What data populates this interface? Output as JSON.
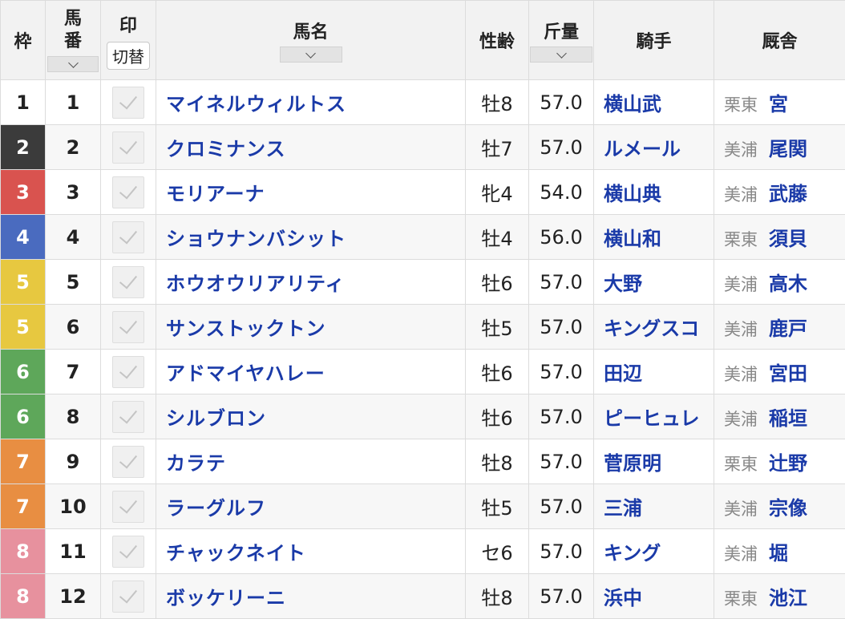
{
  "header": {
    "waku": "枠",
    "umaban_line1": "馬",
    "umaban_line2": "番",
    "mark": "印",
    "mark_toggle": "切替",
    "name": "馬名",
    "sexage": "性齢",
    "weight": "斤量",
    "jockey": "騎手",
    "stable": "厩舎"
  },
  "colors": {
    "link": "#1a3aa8",
    "waku": {
      "1": "#ffffff",
      "2": "#3b3b3b",
      "3": "#d9534f",
      "4": "#4a6bbf",
      "5": "#e7c840",
      "6": "#5ea75a",
      "7": "#e88e42",
      "8": "#e7919e"
    },
    "waku_text": {
      "1": "#222222",
      "2": "#ffffff",
      "3": "#ffffff",
      "4": "#ffffff",
      "5": "#ffffff",
      "6": "#ffffff",
      "7": "#ffffff",
      "8": "#ffffff"
    }
  },
  "rows": [
    {
      "waku": "1",
      "umaban": "1",
      "name": "マイネルウィルトス",
      "sexage": "牡8",
      "weight": "57.0",
      "jockey": "横山武",
      "region": "栗東",
      "trainer": "宮"
    },
    {
      "waku": "2",
      "umaban": "2",
      "name": "クロミナンス",
      "sexage": "牡7",
      "weight": "57.0",
      "jockey": "ルメール",
      "region": "美浦",
      "trainer": "尾関"
    },
    {
      "waku": "3",
      "umaban": "3",
      "name": "モリアーナ",
      "sexage": "牝4",
      "weight": "54.0",
      "jockey": "横山典",
      "region": "美浦",
      "trainer": "武藤"
    },
    {
      "waku": "4",
      "umaban": "4",
      "name": "ショウナンバシット",
      "sexage": "牡4",
      "weight": "56.0",
      "jockey": "横山和",
      "region": "栗東",
      "trainer": "須貝"
    },
    {
      "waku": "5",
      "umaban": "5",
      "name": "ホウオウリアリティ",
      "sexage": "牡6",
      "weight": "57.0",
      "jockey": "大野",
      "region": "美浦",
      "trainer": "高木"
    },
    {
      "waku": "5",
      "umaban": "6",
      "name": "サンストックトン",
      "sexage": "牡5",
      "weight": "57.0",
      "jockey": "キングスコ",
      "region": "美浦",
      "trainer": "鹿戸"
    },
    {
      "waku": "6",
      "umaban": "7",
      "name": "アドマイヤハレー",
      "sexage": "牡6",
      "weight": "57.0",
      "jockey": "田辺",
      "region": "美浦",
      "trainer": "宮田"
    },
    {
      "waku": "6",
      "umaban": "8",
      "name": "シルブロン",
      "sexage": "牡6",
      "weight": "57.0",
      "jockey": "ピーヒュレ",
      "region": "美浦",
      "trainer": "稲垣"
    },
    {
      "waku": "7",
      "umaban": "9",
      "name": "カラテ",
      "sexage": "牡8",
      "weight": "57.0",
      "jockey": "菅原明",
      "region": "栗東",
      "trainer": "辻野"
    },
    {
      "waku": "7",
      "umaban": "10",
      "name": "ラーグルフ",
      "sexage": "牡5",
      "weight": "57.0",
      "jockey": "三浦",
      "region": "美浦",
      "trainer": "宗像"
    },
    {
      "waku": "8",
      "umaban": "11",
      "name": "チャックネイト",
      "sexage": "セ6",
      "weight": "57.0",
      "jockey": "キング",
      "region": "美浦",
      "trainer": "堀"
    },
    {
      "waku": "8",
      "umaban": "12",
      "name": "ボッケリーニ",
      "sexage": "牡8",
      "weight": "57.0",
      "jockey": "浜中",
      "region": "栗東",
      "trainer": "池江"
    }
  ]
}
